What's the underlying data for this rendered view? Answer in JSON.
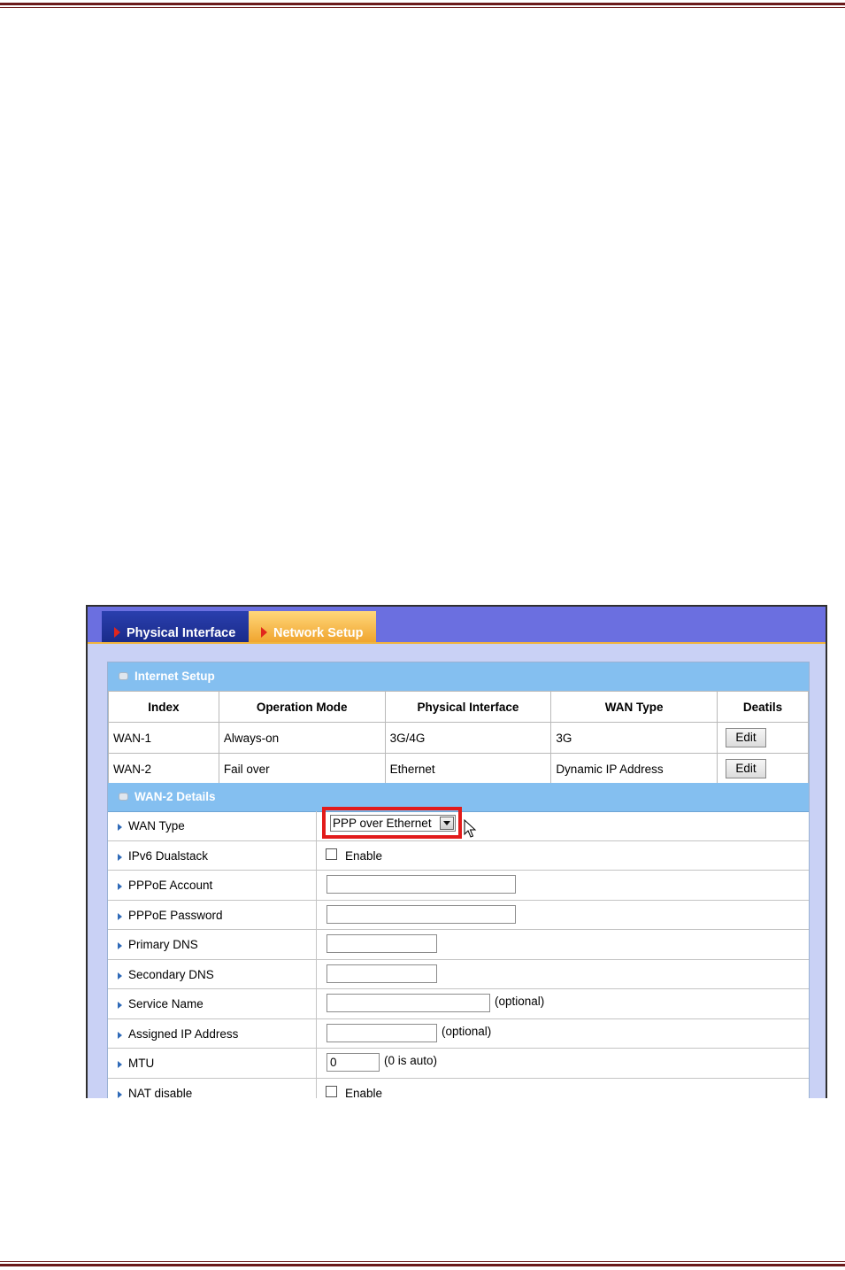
{
  "tabs": [
    {
      "label": "Physical Interface"
    },
    {
      "label": "Network Setup"
    }
  ],
  "internet_setup": {
    "title": "Internet Setup",
    "columns": [
      "Index",
      "Operation Mode",
      "Physical Interface",
      "WAN Type",
      "Deatils"
    ],
    "rows": [
      {
        "index": "WAN-1",
        "mode": "Always-on",
        "interface": "3G/4G",
        "wan_type": "3G",
        "action": "Edit"
      },
      {
        "index": "WAN-2",
        "mode": "Fail over",
        "interface": "Ethernet",
        "wan_type": "Dynamic IP Address",
        "action": "Edit"
      }
    ]
  },
  "details": {
    "title": "WAN-2 Details",
    "wan_type": {
      "label": "WAN Type",
      "value": "PPP over Ethernet"
    },
    "ipv6": {
      "label": "IPv6 Dualstack",
      "check_label": "Enable"
    },
    "pppoe_account": {
      "label": "PPPoE Account",
      "value": ""
    },
    "pppoe_password": {
      "label": "PPPoE Password",
      "value": ""
    },
    "primary_dns": {
      "label": "Primary DNS",
      "value": ""
    },
    "secondary_dns": {
      "label": "Secondary DNS",
      "value": ""
    },
    "service_name": {
      "label": "Service Name",
      "value": "",
      "hint": "(optional)"
    },
    "assigned_ip": {
      "label": "Assigned IP Address",
      "value": "",
      "hint": "(optional)"
    },
    "mtu": {
      "label": "MTU",
      "value": "0",
      "hint": "(0 is auto)"
    },
    "nat_disable": {
      "label": "NAT disable",
      "check_label": "Enable"
    }
  },
  "colors": {
    "rule": "#6b1a1a",
    "highlight": "#e21b1b",
    "section_header": "#84bff0"
  }
}
